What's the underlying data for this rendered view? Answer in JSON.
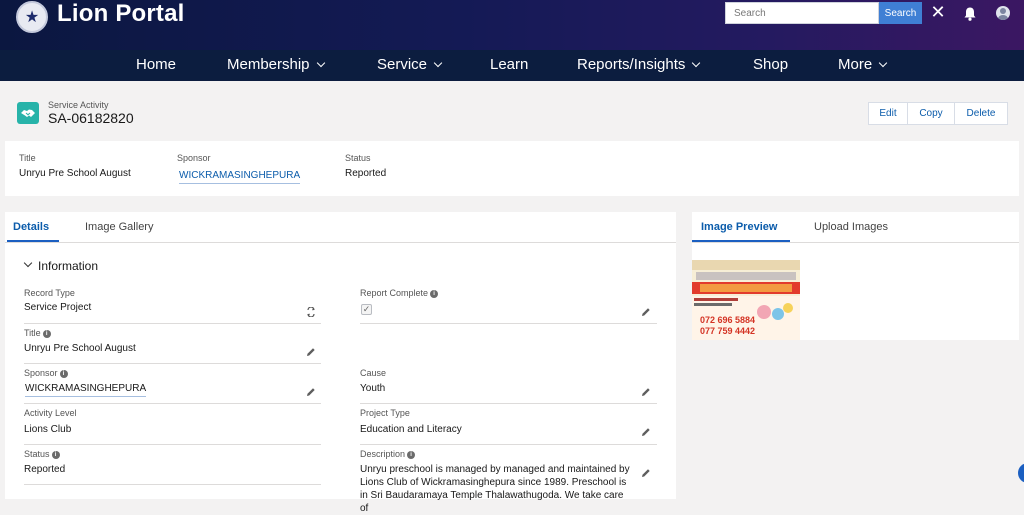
{
  "header": {
    "brand": "Lion Portal",
    "search_placeholder": "Search",
    "search_button": "Search"
  },
  "nav": {
    "items": [
      {
        "label": "Home",
        "has_dropdown": false
      },
      {
        "label": "Membership",
        "has_dropdown": true
      },
      {
        "label": "Service",
        "has_dropdown": true
      },
      {
        "label": "Learn",
        "has_dropdown": false
      },
      {
        "label": "Reports/Insights",
        "has_dropdown": true
      },
      {
        "label": "Shop",
        "has_dropdown": false
      },
      {
        "label": "More",
        "has_dropdown": true
      }
    ]
  },
  "record": {
    "type_label": "Service Activity",
    "name": "SA-06182820",
    "actions": [
      "Edit",
      "Copy",
      "Delete"
    ]
  },
  "highlights": {
    "title_label": "Title",
    "title_value": "Unryu Pre School August",
    "sponsor_label": "Sponsor",
    "sponsor_value": "WICKRAMASINGHEPURA",
    "status_label": "Status",
    "status_value": "Reported"
  },
  "left_tabs": {
    "details": "Details",
    "gallery": "Image Gallery"
  },
  "section": {
    "title": "Information"
  },
  "fields": {
    "record_type_label": "Record Type",
    "record_type_value": "Service Project",
    "report_complete_label": "Report Complete",
    "report_complete_checked": true,
    "title_label": "Title",
    "title_value": "Unryu Pre School August",
    "sponsor_label": "Sponsor",
    "sponsor_value": "WICKRAMASINGHEPURA",
    "cause_label": "Cause",
    "cause_value": "Youth",
    "activity_level_label": "Activity Level",
    "activity_level_value": "Lions Club",
    "project_type_label": "Project Type",
    "project_type_value": "Education and Literacy",
    "status_label": "Status",
    "status_value": "Reported",
    "description_label": "Description",
    "description_value": "Unryu preschool is managed by managed and maintained by Lions Club of Wickramasinghepura since 1989. Preschool is in Sri Baudaramaya Temple Thalawathugoda. We take care of"
  },
  "right_tabs": {
    "preview": "Image Preview",
    "upload": "Upload Images"
  },
  "preview_image": {
    "phone_1": "072 696 5884",
    "phone_2": "077 759 4442"
  },
  "colors": {
    "header_start": "#0b1740",
    "header_end": "#3b1762",
    "nav_bg": "#0c1d3f",
    "accent": "#1b5fc1",
    "link": "#0b5cab",
    "record_icon": "#27b3a9"
  }
}
